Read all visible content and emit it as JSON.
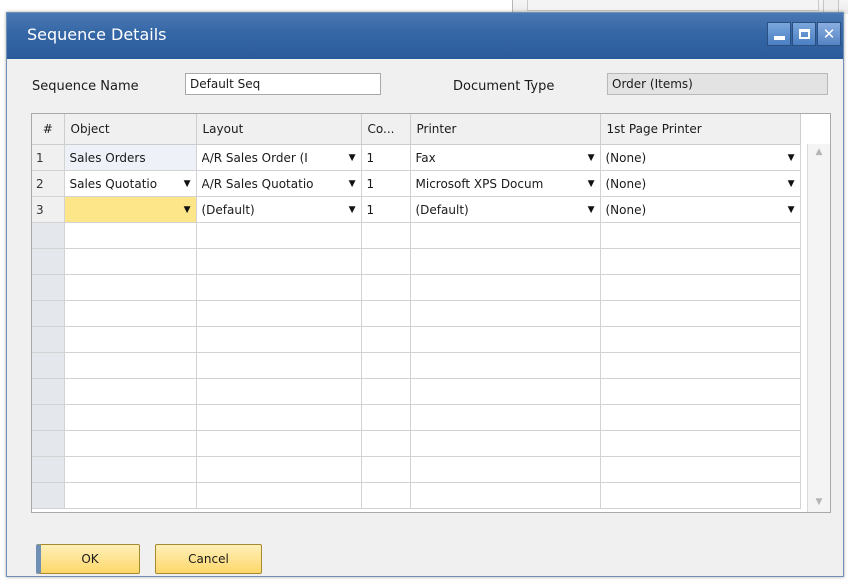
{
  "window": {
    "title": "Sequence Details",
    "controls": [
      "minimize-icon",
      "maximize-icon",
      "close-icon"
    ]
  },
  "form": {
    "sequence_name_label": "Sequence Name",
    "sequence_name_value": "Default Seq",
    "document_type_label": "Document Type",
    "document_type_value": "Order (Items)"
  },
  "grid": {
    "columns": [
      "#",
      "Object",
      "Layout",
      "Co...",
      "Printer",
      "1st Page Printer"
    ],
    "rows": [
      {
        "num": "1",
        "object": "Sales Orders",
        "layout": "A/R Sales Order (I",
        "copies": "1",
        "printer": "Fax",
        "first_page_printer": "(None)"
      },
      {
        "num": "2",
        "object": "Sales Quotatio",
        "layout": "A/R Sales Quotatio",
        "copies": "1",
        "printer": "Microsoft XPS Docum",
        "first_page_printer": "(None)"
      },
      {
        "num": "3",
        "object": "",
        "layout": "(Default)",
        "copies": "1",
        "printer": "(Default)",
        "first_page_printer": "(None)"
      }
    ]
  },
  "buttons": {
    "ok": "OK",
    "cancel": "Cancel"
  },
  "colors": {
    "titlebar": "#3566a5",
    "button_fill": "#fdd76a",
    "active_cell": "#fde58a"
  }
}
